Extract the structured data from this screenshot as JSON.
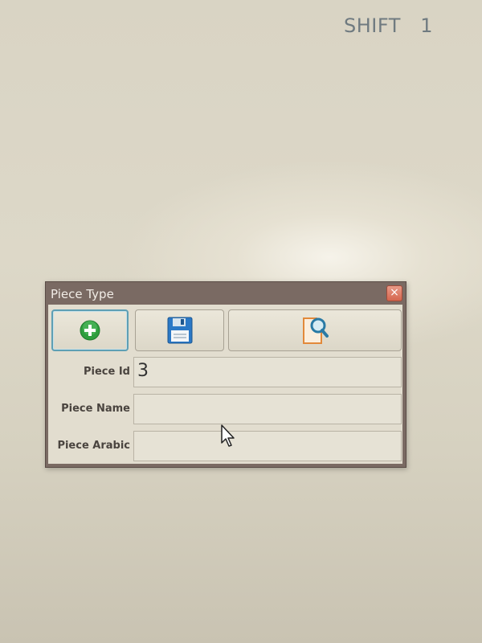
{
  "screen": {
    "shift_text": "SHIFT   1"
  },
  "dialog": {
    "title": "Piece Type",
    "close_glyph": "×",
    "toolbar": [
      {
        "name": "add-button",
        "icon": "plus-circle-icon",
        "color": "#2e9e3e"
      },
      {
        "name": "save-button",
        "icon": "floppy-disk-icon",
        "color": "#2a78c6"
      },
      {
        "name": "search-button",
        "icon": "document-search-icon",
        "color": "#e2893a"
      }
    ],
    "fields": [
      {
        "label": "Piece Id",
        "value": "3"
      },
      {
        "label": "Piece Name",
        "value": ""
      },
      {
        "label": "Piece Arabic",
        "value": ""
      }
    ]
  }
}
